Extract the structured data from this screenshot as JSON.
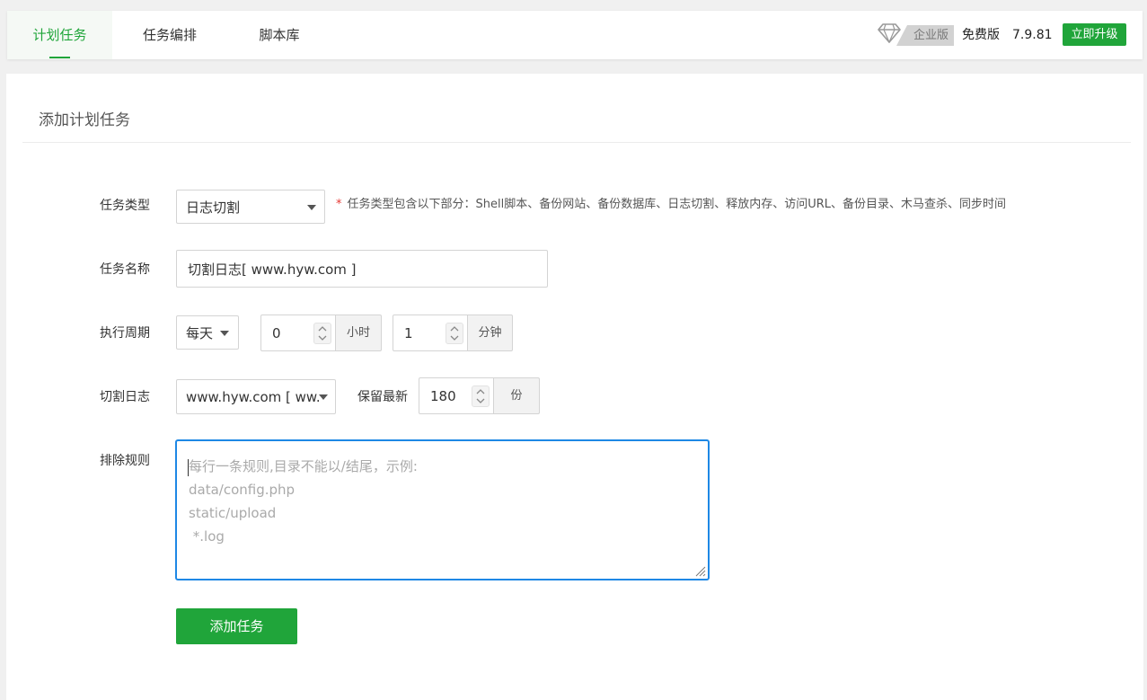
{
  "tabs": [
    {
      "label": "计划任务",
      "active": true
    },
    {
      "label": "任务编排",
      "active": false
    },
    {
      "label": "脚本库",
      "active": false
    }
  ],
  "header": {
    "enterprise_label": "企业版",
    "free_label": "免费版",
    "version": "7.9.81",
    "upgrade_label": "立即升级"
  },
  "panel": {
    "title": "添加计划任务"
  },
  "form": {
    "task_type": {
      "label": "任务类型",
      "value": "日志切割",
      "hint_star": "*",
      "hint": "任务类型包含以下部分：Shell脚本、备份网站、备份数据库、日志切割、释放内存、访问URL、备份目录、木马查杀、同步时间"
    },
    "task_name": {
      "label": "任务名称",
      "value": "切割日志[ www.hyw.com ]"
    },
    "period": {
      "label": "执行周期",
      "frequency": "每天",
      "hour_value": "0",
      "hour_unit": "小时",
      "minute_value": "1",
      "minute_unit": "分钟"
    },
    "cut_log": {
      "label": "切割日志",
      "site_value": "www.hyw.com [ ww...",
      "keep_label": "保留最新",
      "keep_value": "180",
      "keep_unit": "份"
    },
    "exclude": {
      "label": "排除规则",
      "placeholder_lines": [
        "每行一条规则,目录不能以/结尾，示例:",
        "data/config.php",
        "static/upload",
        " *.log"
      ]
    },
    "submit_label": "添加任务"
  },
  "colors": {
    "brand_green": "#20a53a",
    "focus_blue": "#1e88e5",
    "required_red": "#e53935"
  }
}
